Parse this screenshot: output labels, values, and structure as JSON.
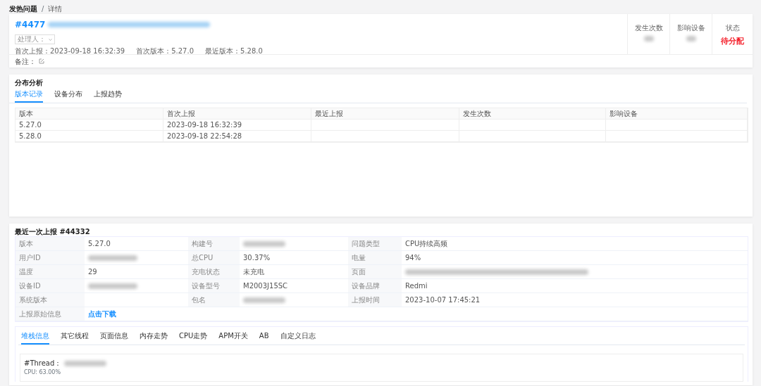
{
  "breadcrumb": [
    {
      "label": "发热问题",
      "selected": false
    },
    {
      "label": "详情",
      "selected": true
    }
  ],
  "breadcrumb_separator": "/",
  "issue": {
    "id": "#4477",
    "title_redacted": true,
    "assignee_label": "处理人：",
    "meta": [
      {
        "label": "首次上报：",
        "value": "2023-09-18 16:32:39"
      },
      {
        "label": "首次版本：",
        "value": "5.27.0"
      },
      {
        "label": "最近版本：",
        "value": "5.28.0"
      }
    ],
    "remark_label": "备注：",
    "stats": [
      {
        "label": "发生次数",
        "kind": "redacted"
      },
      {
        "label": "影响设备",
        "kind": "redacted"
      },
      {
        "label": "状态",
        "kind": "status",
        "value": "待分配"
      }
    ]
  },
  "distribution": {
    "title": "分布分析",
    "tabs": [
      {
        "label": "版本记录",
        "selected": true
      },
      {
        "label": "设备分布",
        "selected": false
      },
      {
        "label": "上报趋势",
        "selected": false
      }
    ],
    "columns": [
      "版本",
      "首次上报",
      "最近上报",
      "发生次数",
      "影响设备"
    ],
    "rows": [
      [
        "5.27.0",
        "2023-09-18 16:32:39"
      ],
      [
        "5.28.0",
        "2023-09-18 22:54:28"
      ]
    ]
  },
  "latest": {
    "title": "最近一次上报 #44332",
    "rows": [
      [
        {
          "label": "版本",
          "kind": "text",
          "value": "5.27.0"
        },
        {
          "label": "构建号",
          "kind": "redacted"
        },
        {
          "label": "问题类型",
          "kind": "text",
          "value": "CPU持续高频"
        }
      ],
      [
        {
          "label": "用户ID",
          "kind": "redacted"
        },
        {
          "label": "总CPU",
          "kind": "text",
          "value": "30.37%"
        },
        {
          "label": "电量",
          "kind": "text",
          "value": "94%"
        }
      ],
      [
        {
          "label": "温度",
          "kind": "text",
          "value": "29"
        },
        {
          "label": "充电状态",
          "kind": "text",
          "value": "未充电"
        },
        {
          "label": "页面",
          "kind": "redacted"
        }
      ],
      [
        {
          "label": "设备ID",
          "kind": "redacted"
        },
        {
          "label": "设备型号",
          "kind": "text",
          "value": "M2003J15SC"
        },
        {
          "label": "设备品牌",
          "kind": "text",
          "value": "Redmi"
        }
      ],
      [
        {
          "label": "系统版本",
          "kind": "empty"
        },
        {
          "label": "包名",
          "kind": "redacted"
        },
        {
          "label": "上报时间",
          "kind": "text",
          "value": "2023-10-07 17:45:21"
        }
      ],
      [
        {
          "label": "上报原始信息",
          "kind": "link",
          "value": "点击下载"
        }
      ]
    ],
    "tabs": [
      {
        "label": "堆栈信息",
        "selected": true
      },
      {
        "label": "其它线程",
        "selected": false
      },
      {
        "label": "页面信息",
        "selected": false
      },
      {
        "label": "内存走势",
        "selected": false
      },
      {
        "label": "CPU走势",
        "selected": false
      },
      {
        "label": "APM开关",
        "selected": false
      },
      {
        "label": "AB",
        "selected": false
      },
      {
        "label": "自定义日志",
        "selected": false
      }
    ],
    "thread": {
      "label": "#Thread：",
      "name_redacted": true,
      "cpu": "CPU: 63.00%"
    }
  }
}
